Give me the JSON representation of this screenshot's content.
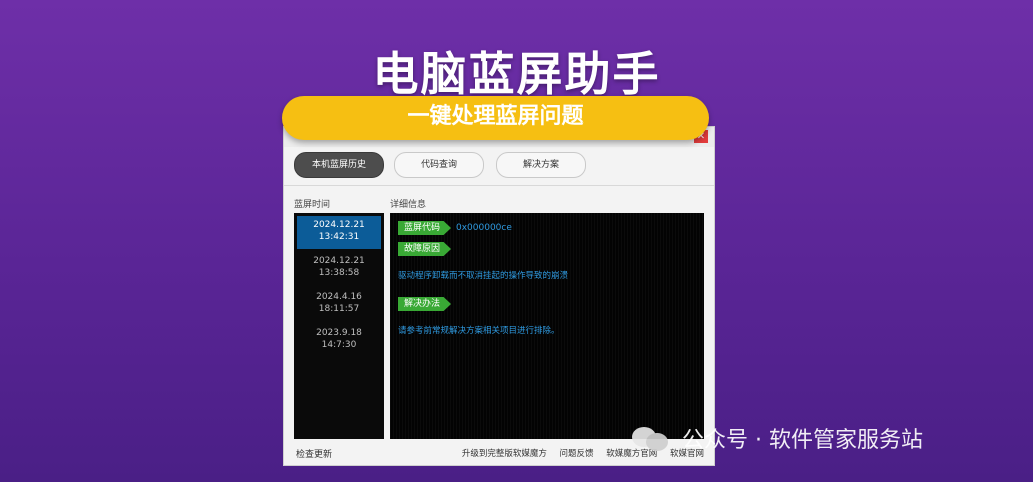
{
  "headline": "电脑蓝屏助手",
  "banner": "一键处理蓝屏问题",
  "window": {
    "title": "电脑蓝屏助手",
    "tabs": [
      "本机蓝屏历史",
      "代码查询",
      "解决方案"
    ],
    "active_tab": 0,
    "left_header": "蓝屏时间",
    "right_header": "详细信息",
    "history": [
      {
        "date": "2024.12.21",
        "time": "13:42:31"
      },
      {
        "date": "2024.12.21",
        "time": "13:38:58"
      },
      {
        "date": "2024.4.16",
        "time": "18:11:57"
      },
      {
        "date": "2023.9.18",
        "time": "14:7:30"
      }
    ],
    "detail": {
      "code_label": "蓝屏代码",
      "code_value": "0x000000ce",
      "cause_label": "故障原因",
      "cause_text": "驱动程序卸载而不取消挂起的操作导致的崩溃",
      "solution_label": "解决办法",
      "solution_text": "请参考前常规解决方案相关项目进行排除。"
    },
    "footer": {
      "check_update": "检查更新",
      "links": [
        "升级到完整版软媒魔方",
        "问题反馈",
        "软媒魔方官网",
        "软媒官网"
      ]
    }
  },
  "watermark": "公众号 · 软件管家服务站",
  "colors": {
    "accent_yellow": "#f6bf12",
    "tag_green": "#39a935",
    "selected_blue": "#0c5c98",
    "info_blue": "#2f9ae0"
  }
}
